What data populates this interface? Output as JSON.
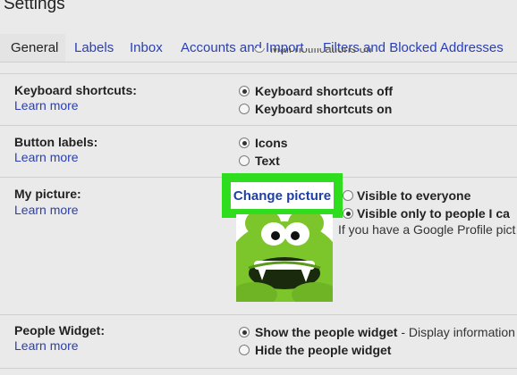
{
  "page": {
    "title": "Settings"
  },
  "tabs": [
    "General",
    "Labels",
    "Inbox",
    "Accounts and Import",
    "Filters and Blocked Addresses"
  ],
  "cut_off_text": "Mail notifications off",
  "keyboard": {
    "label": "Keyboard shortcuts:",
    "learn_more": "Learn more",
    "options": [
      "Keyboard shortcuts off",
      "Keyboard shortcuts on"
    ],
    "selected": 0
  },
  "buttons": {
    "label": "Button labels:",
    "learn_more": "Learn more",
    "options": [
      "Icons",
      "Text"
    ],
    "selected": 0
  },
  "picture": {
    "label": "My picture:",
    "learn_more": "Learn more",
    "change_button": "Change picture",
    "options": [
      "Visible to everyone",
      "Visible only to people I ca"
    ],
    "selected": 1,
    "hint": "If you have a Google Profile pict"
  },
  "people": {
    "label": "People Widget:",
    "learn_more": "Learn more",
    "options": [
      "Show the people widget",
      "Hide the people widget"
    ],
    "show_desc": " - Display information",
    "selected": 0
  },
  "colors": {
    "highlight": "#2edd1e",
    "link": "#2a3fb3",
    "avatar": "#7cc52b"
  },
  "icons": [
    "radio-icon",
    "avatar-image"
  ]
}
